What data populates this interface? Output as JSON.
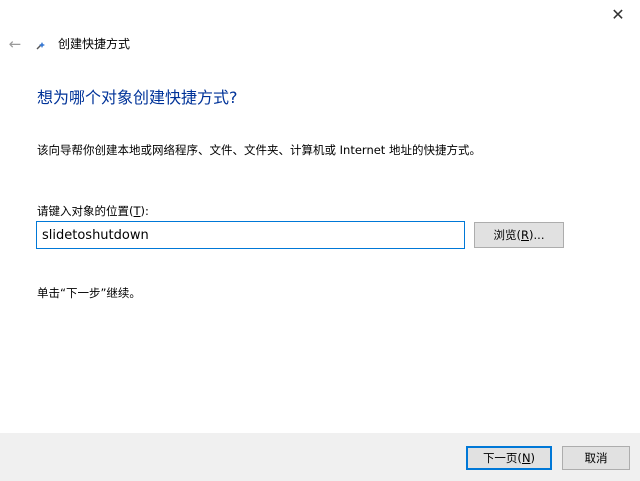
{
  "window": {
    "close_symbol": "✕"
  },
  "nav": {
    "back_symbol": "←"
  },
  "wizard": {
    "title": "创建快捷方式",
    "heading": "想为哪个对象创建快捷方式?",
    "description": "该向导帮你创建本地或网络程序、文件、文件夹、计算机或 Internet 地址的快捷方式。",
    "location_label_prefix": "请键入对象的位置(",
    "location_label_accel": "T",
    "location_label_suffix": "):",
    "location_value": "slidetoshutdown",
    "hint": "单击“下一步”继续。"
  },
  "buttons": {
    "browse_prefix": "浏览(",
    "browse_accel": "R",
    "browse_suffix": ")...",
    "next_prefix": "下一页(",
    "next_accel": "N",
    "next_suffix": ")",
    "cancel": "取消"
  },
  "colors": {
    "heading": "#003399",
    "focus_border": "#0078d7",
    "footer_bg": "#f0f0f0",
    "button_bg": "#e1e1e1"
  },
  "icons": {
    "close": "close-icon",
    "back": "back-arrow-icon",
    "wizard": "shortcut-wizard-icon"
  }
}
